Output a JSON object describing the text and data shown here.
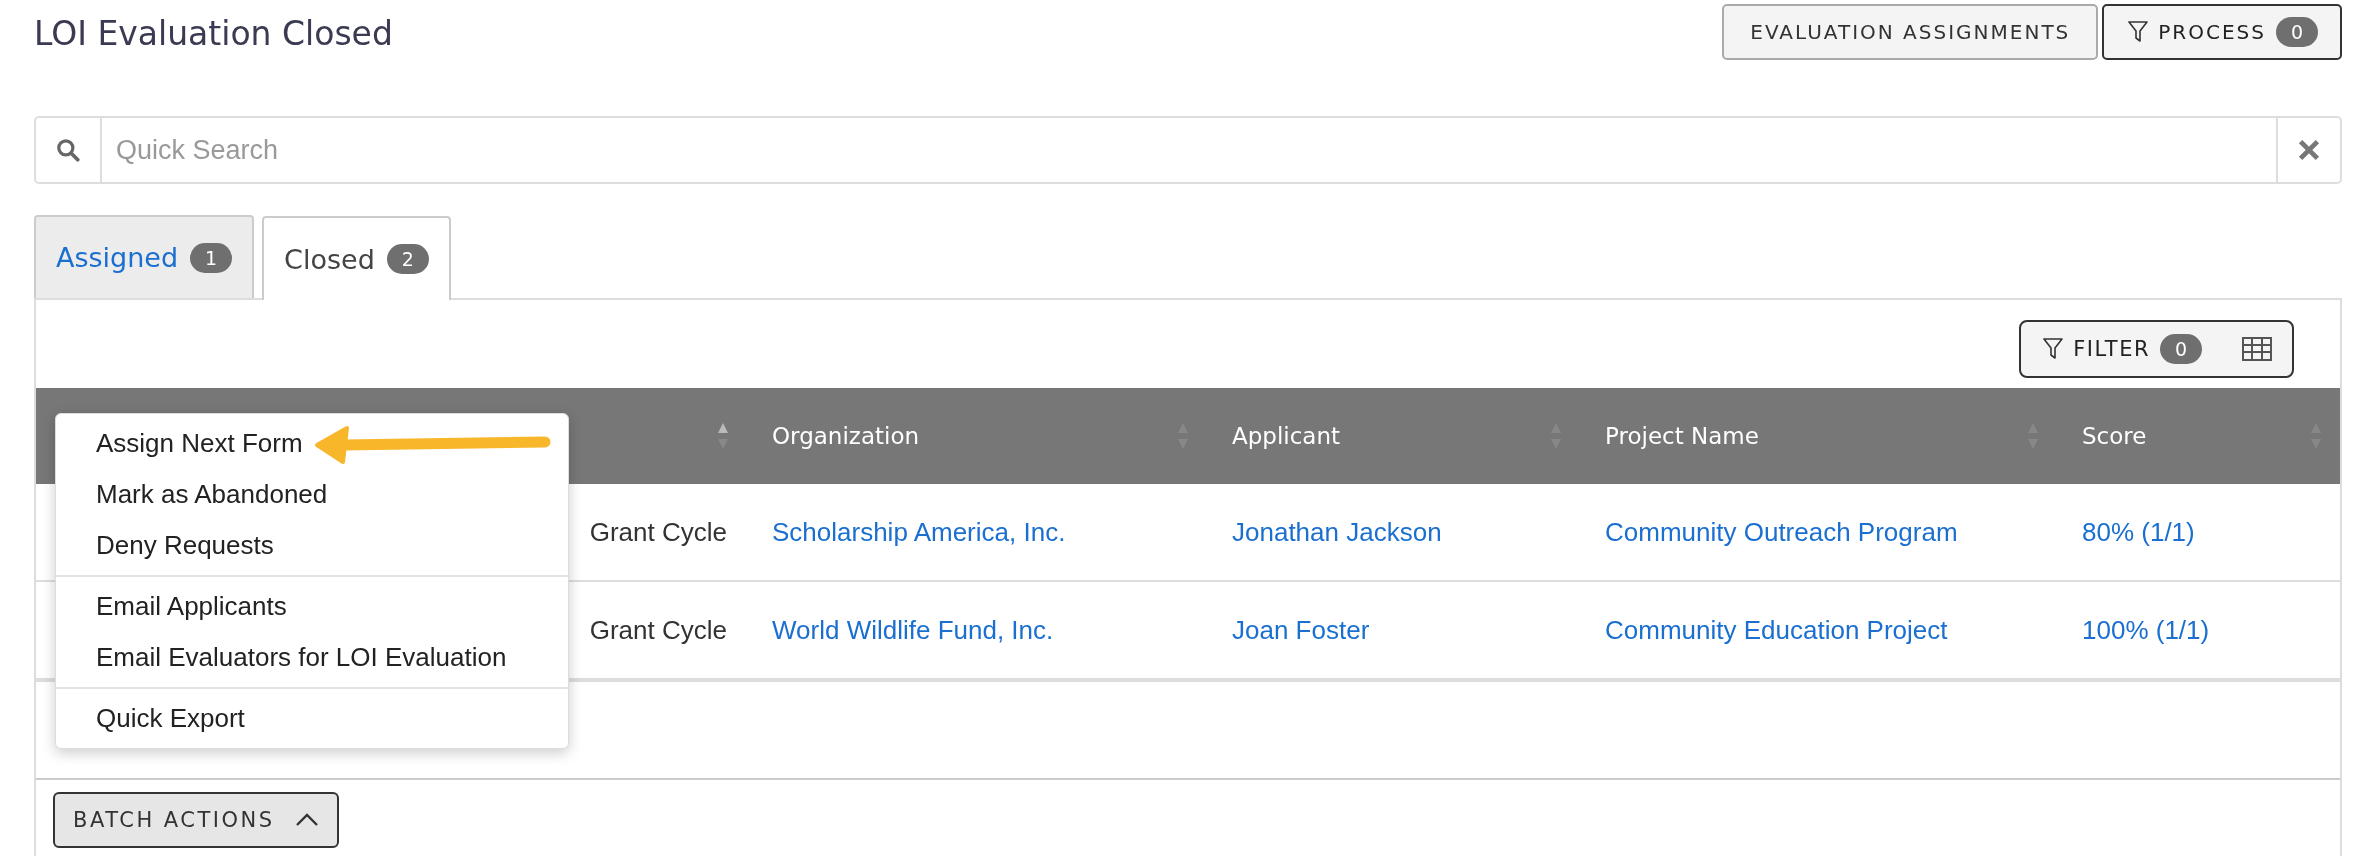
{
  "page": {
    "title": "LOI Evaluation Closed"
  },
  "header_buttons": [
    {
      "label": "EVALUATION ASSIGNMENTS",
      "kind": "plain"
    },
    {
      "label": "PROCESS",
      "kind": "filter",
      "count": "0"
    }
  ],
  "search": {
    "placeholder": "Quick Search"
  },
  "tabs": [
    {
      "label": "Assigned",
      "count": "1",
      "selected": false
    },
    {
      "label": "Closed",
      "count": "2",
      "selected": true
    }
  ],
  "filter": {
    "label": "FILTER",
    "count": "0"
  },
  "table": {
    "columns": [
      "Organization",
      "Applicant",
      "Project Name",
      "Score"
    ],
    "rows": [
      {
        "column_1": "Grant Cycle",
        "links": [
          "Scholarship America, Inc.",
          "Jonathan Jackson",
          "Community Outreach Program",
          "80% (1/1)"
        ]
      },
      {
        "column_1": "Grant Cycle",
        "links": [
          "World Wildlife Fund, Inc.",
          "Joan Foster",
          "Community Education Project",
          "100% (1/1)"
        ]
      }
    ]
  },
  "batch_actions": {
    "label": "BATCH ACTIONS",
    "expanded": true,
    "groups": [
      [
        {
          "label": "Assign Next Form",
          "pointed": true
        },
        {
          "label": "Mark as Abandoned",
          "pointed": false
        },
        {
          "label": "Deny Requests",
          "pointed": false
        }
      ],
      [
        {
          "label": "Email Applicants",
          "pointed": false
        },
        {
          "label": "Email Evaluators for LOI Evaluation",
          "pointed": false
        }
      ],
      [
        {
          "label": "Quick Export",
          "pointed": false
        }
      ]
    ]
  }
}
